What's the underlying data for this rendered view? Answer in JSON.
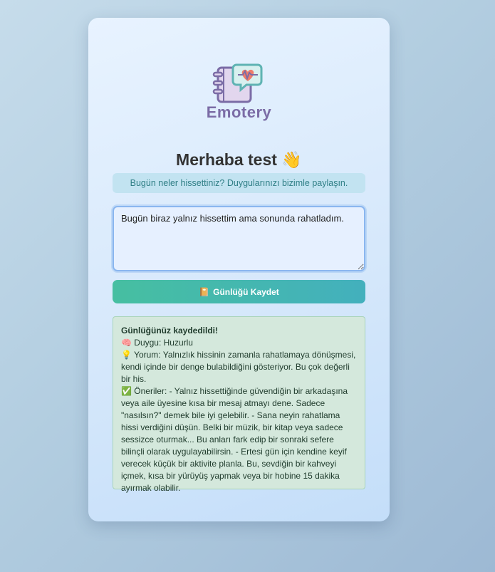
{
  "app": {
    "name": "Emotery"
  },
  "greeting": {
    "text": "Merhaba test 👋"
  },
  "info": {
    "text": "Bugün neler hissettiniz? Duygularınızı bizimle paylaşın."
  },
  "entry": {
    "value": "Bugün biraz yalnız hissettim ama sonunda rahatladım."
  },
  "save_button": {
    "icon": "📔",
    "label": "Günlüğü Kaydet"
  },
  "result": {
    "title": "Günlüğünüz kaydedildi!",
    "emotion": "🧠 Duygu: Huzurlu",
    "comment": "💡 Yorum: Yalnızlık hissinin zamanla rahatlamaya dönüşmesi, kendi içinde bir denge bulabildiğini gösteriyor. Bu çok değerli bir his.",
    "suggestions": "✅ Öneriler: - Yalnız hissettiğinde güvendiğin bir arkadaşına veya aile üyesine kısa bir mesaj atmayı dene. Sadece \"nasılsın?\" demek bile iyi gelebilir. - Sana neyin rahatlama hissi verdiğini düşün. Belki bir müzik, bir kitap veya sadece sessizce oturmak... Bu anları fark edip bir sonraki sefere bilinçli olarak uygulayabilirsin. - Ertesi gün için kendine keyif verecek küçük bir aktivite planla. Bu, sevdiğin bir kahveyi içmek, kısa bir yürüyüş yapmak veya bir hobine 15 dakika ayırmak olabilir."
  },
  "colors": {
    "brand": "#7b6ca6",
    "accent_start": "#46bfa1",
    "accent_end": "#43b0bd",
    "info_bg": "#c2e3f1",
    "success_bg": "#d4e8dc"
  }
}
